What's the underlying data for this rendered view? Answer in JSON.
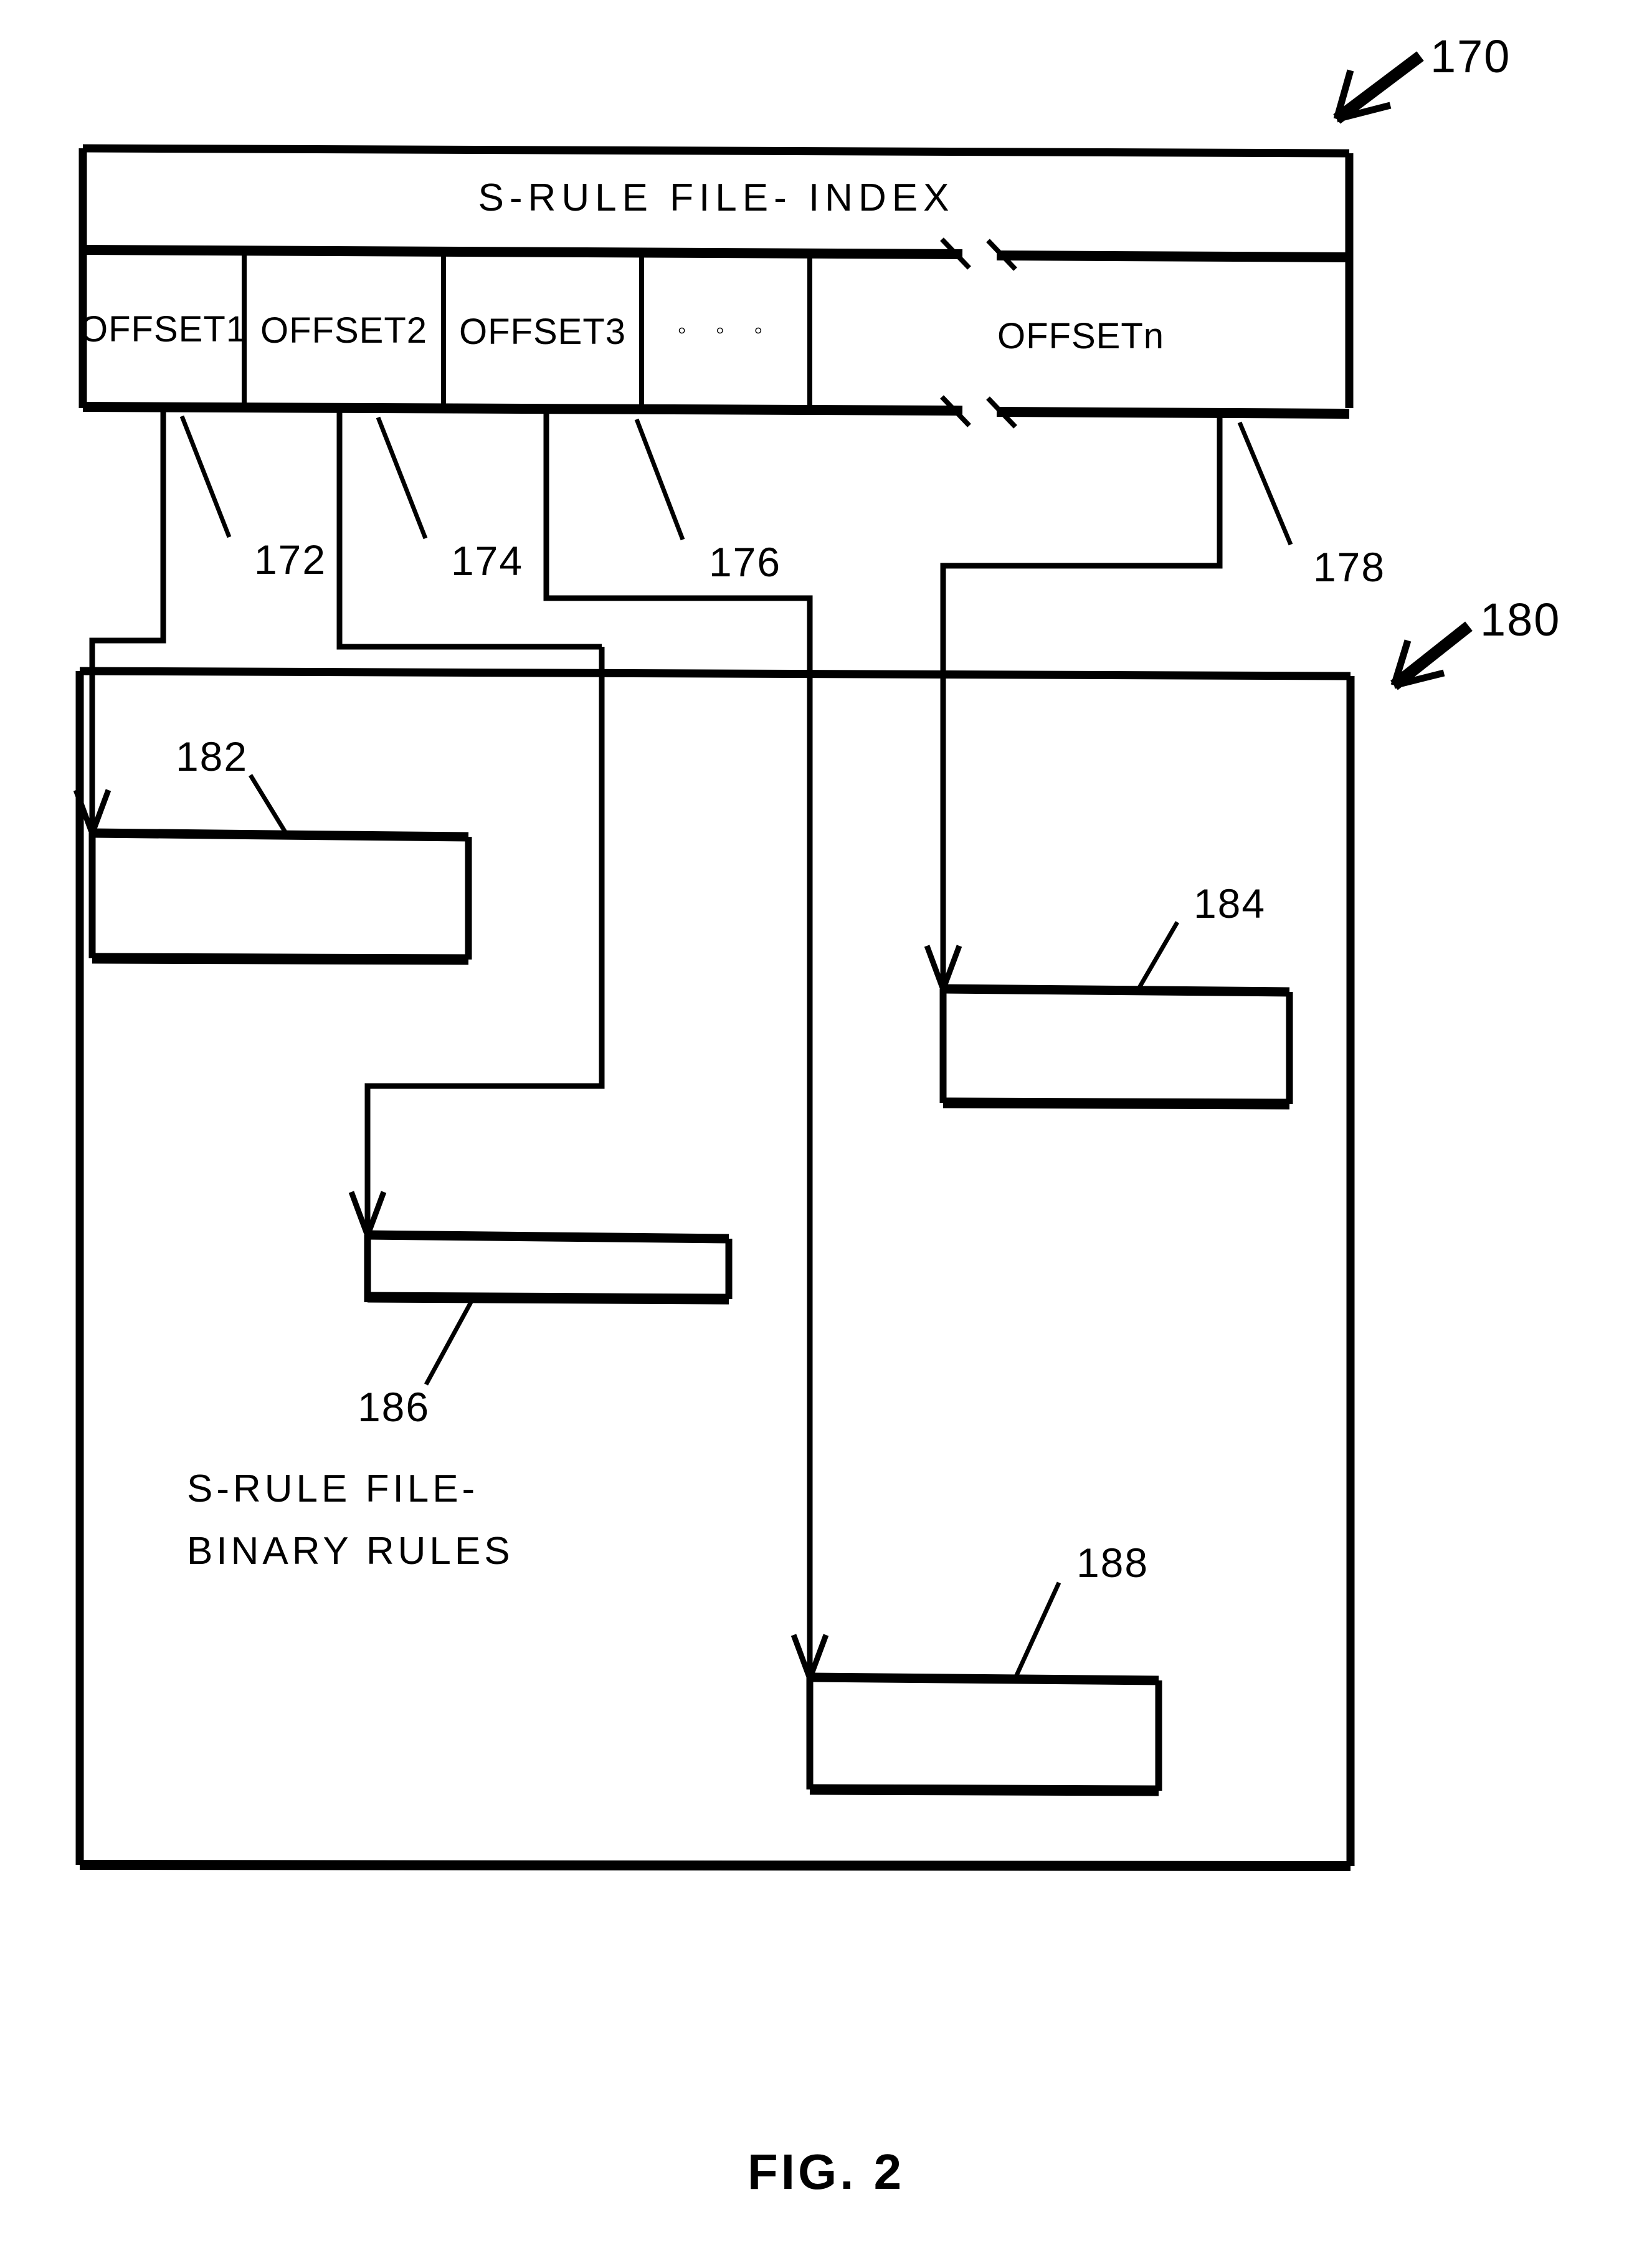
{
  "figure": {
    "caption": "FIG. 2",
    "index_ref": "170",
    "binary_ref": "180"
  },
  "index_table": {
    "header": "S-RULE FILE- INDEX",
    "cells": [
      {
        "label": "OFFSET1",
        "ref": "172"
      },
      {
        "label": "OFFSET2",
        "ref": "174"
      },
      {
        "label": "OFFSET3",
        "ref": "176"
      },
      {
        "label": "◦ ◦ ◦",
        "ref": ""
      },
      {
        "label": "OFFSETn",
        "ref": "178"
      }
    ]
  },
  "binary_region": {
    "label_line1": "S-RULE FILE-",
    "label_line2": "BINARY RULES",
    "rules": [
      {
        "ref": "182"
      },
      {
        "ref": "184"
      },
      {
        "ref": "186"
      },
      {
        "ref": "188"
      }
    ]
  },
  "colors": {
    "ink": "#000000",
    "paper": "#ffffff"
  }
}
